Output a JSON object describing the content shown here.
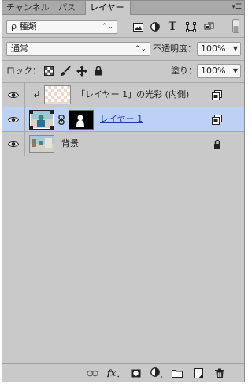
{
  "tabs": [
    {
      "label": "チャンネル",
      "active": false
    },
    {
      "label": "パス",
      "active": false
    },
    {
      "label": "レイヤー",
      "active": true
    }
  ],
  "tab_menu": "▾☰",
  "filter": {
    "value": "ρ 種類",
    "arrows": "⌃⌄"
  },
  "blend_mode": {
    "value": "通常",
    "arrows": "⌃⌄"
  },
  "opacity": {
    "label": "不透明度：",
    "value": "100%"
  },
  "lock": {
    "label": "ロック："
  },
  "fill": {
    "label": "塗り：",
    "value": "100%"
  },
  "layers": [
    {
      "name": "「レイヤー 1」の光彩 (内側)",
      "selected": false,
      "clipped": true
    },
    {
      "name": "レイヤー 1",
      "selected": true,
      "clipped": false
    },
    {
      "name": "背景",
      "selected": false,
      "clipped": false,
      "locked": true
    }
  ],
  "colors": {
    "panel": "#c9c9c9",
    "selected_row": "#bcd1f5",
    "accent": "#3f6fd3"
  }
}
